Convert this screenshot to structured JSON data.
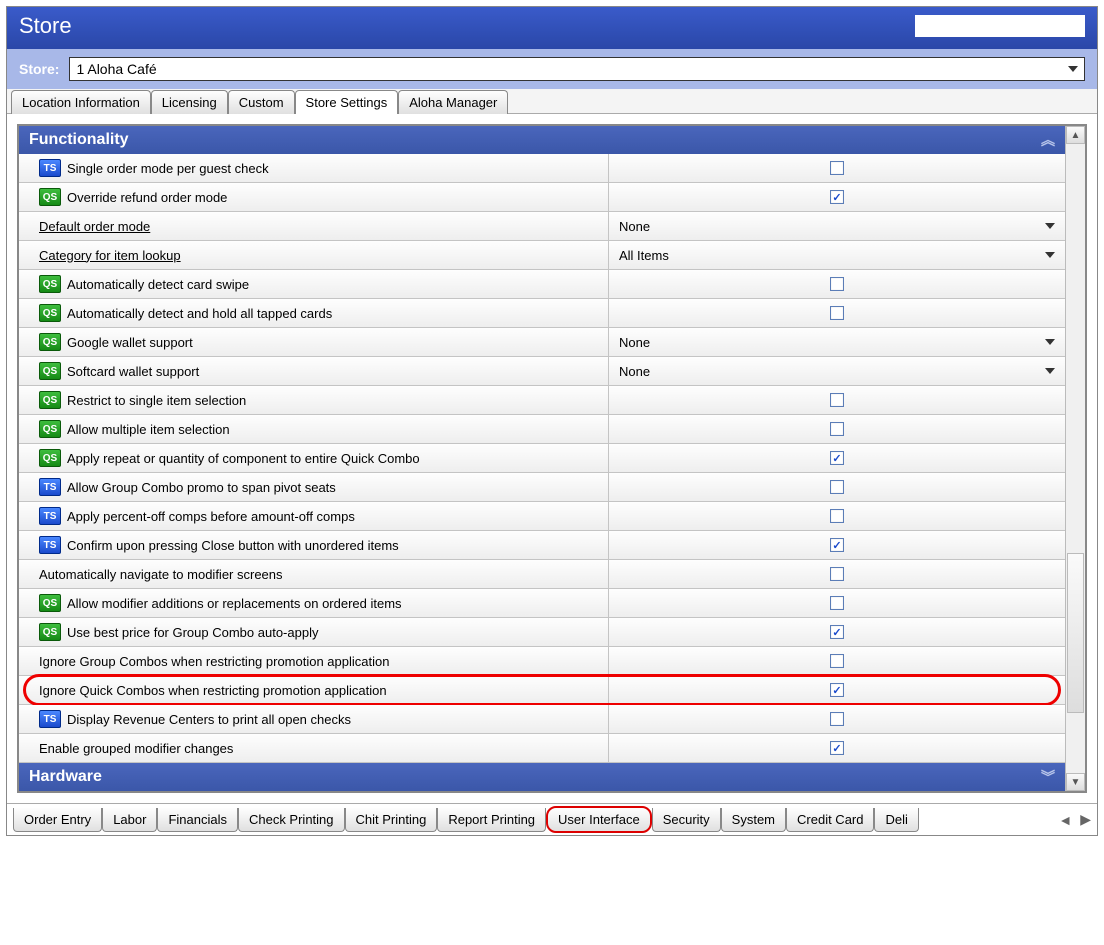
{
  "window": {
    "title": "Store"
  },
  "store": {
    "label": "Store:",
    "value": "1 Aloha Café"
  },
  "tabs_top": [
    {
      "label": "Location Information",
      "active": false
    },
    {
      "label": "Licensing",
      "active": false
    },
    {
      "label": "Custom",
      "active": false
    },
    {
      "label": "Store Settings",
      "active": true
    },
    {
      "label": "Aloha Manager",
      "active": false
    }
  ],
  "tabs_bottom": [
    {
      "label": "Order Entry"
    },
    {
      "label": "Labor"
    },
    {
      "label": "Financials"
    },
    {
      "label": "Check Printing"
    },
    {
      "label": "Chit Printing"
    },
    {
      "label": "Report Printing"
    },
    {
      "label": "User Interface",
      "highlight": true
    },
    {
      "label": "Security"
    },
    {
      "label": "System"
    },
    {
      "label": "Credit Card"
    },
    {
      "label": "Deli"
    }
  ],
  "sections": {
    "functionality": "Functionality",
    "hardware": "Hardware"
  },
  "rows": [
    {
      "icon": "TS",
      "label": "Single order mode per guest check",
      "type": "check",
      "checked": false
    },
    {
      "icon": "QS",
      "label": "Override refund order mode",
      "type": "check",
      "checked": true
    },
    {
      "icon": "",
      "label": "Default order mode",
      "link": true,
      "type": "dropdown",
      "value": "None"
    },
    {
      "icon": "",
      "label": "Category for item lookup",
      "link": true,
      "type": "dropdown",
      "value": "All Items"
    },
    {
      "icon": "QS",
      "label": "Automatically detect card swipe",
      "type": "check",
      "checked": false
    },
    {
      "icon": "QS",
      "label": "Automatically detect and hold all tapped cards",
      "type": "check",
      "checked": false
    },
    {
      "icon": "QS",
      "label": "Google wallet support",
      "type": "dropdown",
      "value": "None"
    },
    {
      "icon": "QS",
      "label": "Softcard wallet support",
      "type": "dropdown",
      "value": "None"
    },
    {
      "icon": "QS",
      "label": "Restrict to single item selection",
      "type": "check",
      "checked": false
    },
    {
      "icon": "QS",
      "label": "Allow multiple item selection",
      "type": "check",
      "checked": false
    },
    {
      "icon": "QS",
      "label": "Apply repeat or quantity of component to entire Quick Combo",
      "type": "check",
      "checked": true
    },
    {
      "icon": "TS",
      "label": "Allow Group Combo promo to span pivot seats",
      "type": "check",
      "checked": false
    },
    {
      "icon": "TS",
      "label": "Apply percent-off comps before amount-off comps",
      "type": "check",
      "checked": false
    },
    {
      "icon": "TS",
      "label": "Confirm upon pressing Close button with unordered items",
      "type": "check",
      "checked": true
    },
    {
      "icon": "",
      "label": "Automatically navigate to modifier screens",
      "type": "check",
      "checked": false
    },
    {
      "icon": "QS",
      "label": "Allow modifier additions or replacements on ordered items",
      "type": "check",
      "checked": false
    },
    {
      "icon": "QS",
      "label": "Use best price for Group Combo auto-apply",
      "type": "check",
      "checked": true
    },
    {
      "icon": "",
      "label": "Ignore Group Combos when restricting promotion application",
      "type": "check",
      "checked": false
    },
    {
      "icon": "",
      "label": "Ignore Quick Combos when restricting promotion application",
      "type": "check",
      "checked": true,
      "highlight": true
    },
    {
      "icon": "TS",
      "label": "Display Revenue Centers to print all open checks",
      "type": "check",
      "checked": false
    },
    {
      "icon": "",
      "label": "Enable grouped modifier changes",
      "type": "check",
      "checked": true
    }
  ]
}
